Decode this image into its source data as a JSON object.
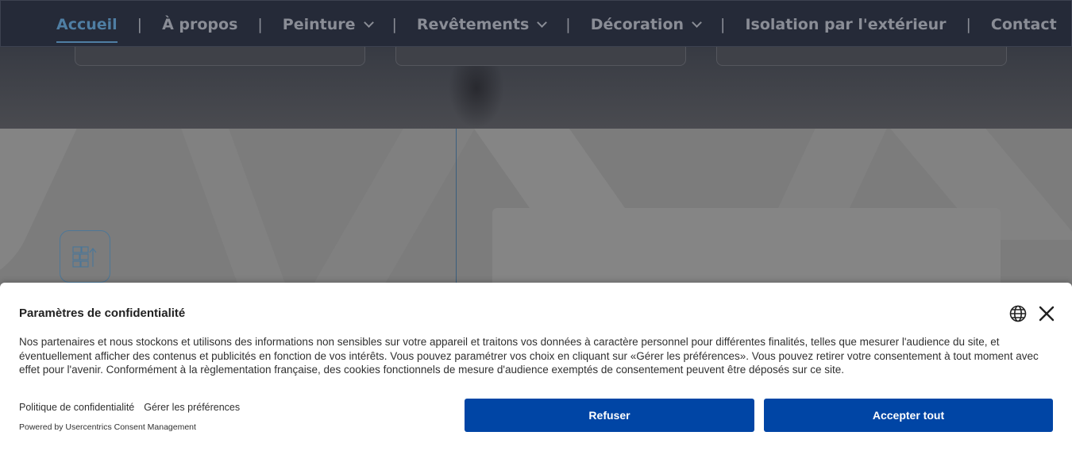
{
  "nav": {
    "items": [
      {
        "label": "Accueil",
        "active": true,
        "dropdown": false
      },
      {
        "label": "À propos",
        "active": false,
        "dropdown": false
      },
      {
        "label": "Peinture",
        "active": false,
        "dropdown": true
      },
      {
        "label": "Revêtements",
        "active": false,
        "dropdown": true
      },
      {
        "label": "Décoration",
        "active": false,
        "dropdown": true
      },
      {
        "label": "Isolation par l'extérieur",
        "active": false,
        "dropdown": false
      },
      {
        "label": "Contact",
        "active": false,
        "dropdown": false
      }
    ],
    "separator": "|"
  },
  "section": {
    "icon": "shelves-icon"
  },
  "cookie_banner": {
    "title": "Paramètres de confidentialité",
    "text": "Nos partenaires et nous stockons et utilisons des informations non sensibles sur votre appareil et traitons vos données à caractère personnel pour différentes finalités, telles que mesurer l'audience du site, et éventuellement afficher des contenus et publicités en fonction de vos intérêts. Vous pouvez paramétrer vos choix en cliquant sur «Gérer les préférences». Vous pouvez retirer votre consentement à tout moment avec effet pour l'avenir. Conformément à la règlementation française, des cookies fonctionnels de mesure d'audience exemptés de consentement peuvent être déposés sur ce site.",
    "privacy_link": "Politique de confidentialité",
    "preferences_link": "Gérer les préférences",
    "powered_by": "Powered by Usercentrics Consent Management",
    "refuse_label": "Refuser",
    "accept_label": "Accepter tout",
    "icons": [
      "globe-icon",
      "close-icon"
    ]
  },
  "colors": {
    "button": "#0045a5",
    "nav_active": "#4f7ea3",
    "nav_background": "#252a38"
  }
}
